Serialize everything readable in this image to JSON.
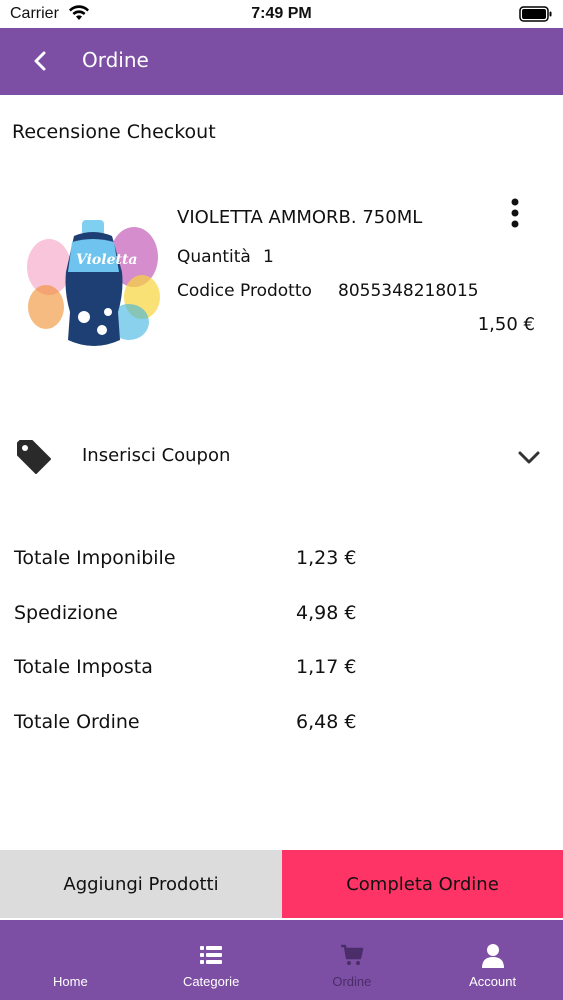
{
  "status_bar": {
    "carrier": "Carrier",
    "time": "7:49 PM"
  },
  "header": {
    "title": "Ordine",
    "back_icon": "chevron-left-icon"
  },
  "page": {
    "section_title": "Recensione Checkout"
  },
  "product": {
    "name": "VIOLETTA AMMORB. 750ML",
    "quantity_label": "Quantità",
    "quantity": "1",
    "code_label": "Codice Prodotto",
    "code": "8055348218015",
    "price": "1,50 €",
    "image_text": "Violetta"
  },
  "coupon": {
    "label": "Inserisci Coupon",
    "icon": "tag-icon"
  },
  "totals": [
    {
      "label": "Totale Imponibile",
      "value": "1,23 €"
    },
    {
      "label": "Spedizione",
      "value": "4,98 €"
    },
    {
      "label": "Totale Imposta",
      "value": "1,17 €"
    },
    {
      "label": "Totale Ordine",
      "value": "6,48 €"
    }
  ],
  "actions": {
    "add_products": "Aggiungi Prodotti",
    "complete_order": "Completa Ordine"
  },
  "tabs": [
    {
      "label": "Home",
      "icon": "home-icon",
      "active": false
    },
    {
      "label": "Categorie",
      "icon": "list-icon",
      "active": false
    },
    {
      "label": "Ordine",
      "icon": "cart-icon",
      "active": true
    },
    {
      "label": "Account",
      "icon": "user-icon",
      "active": false
    }
  ],
  "colors": {
    "primary": "#7c4fa5",
    "accent": "#fe3466",
    "secondary_button": "#dcdcdc",
    "active_tab": "#4a2d69"
  }
}
